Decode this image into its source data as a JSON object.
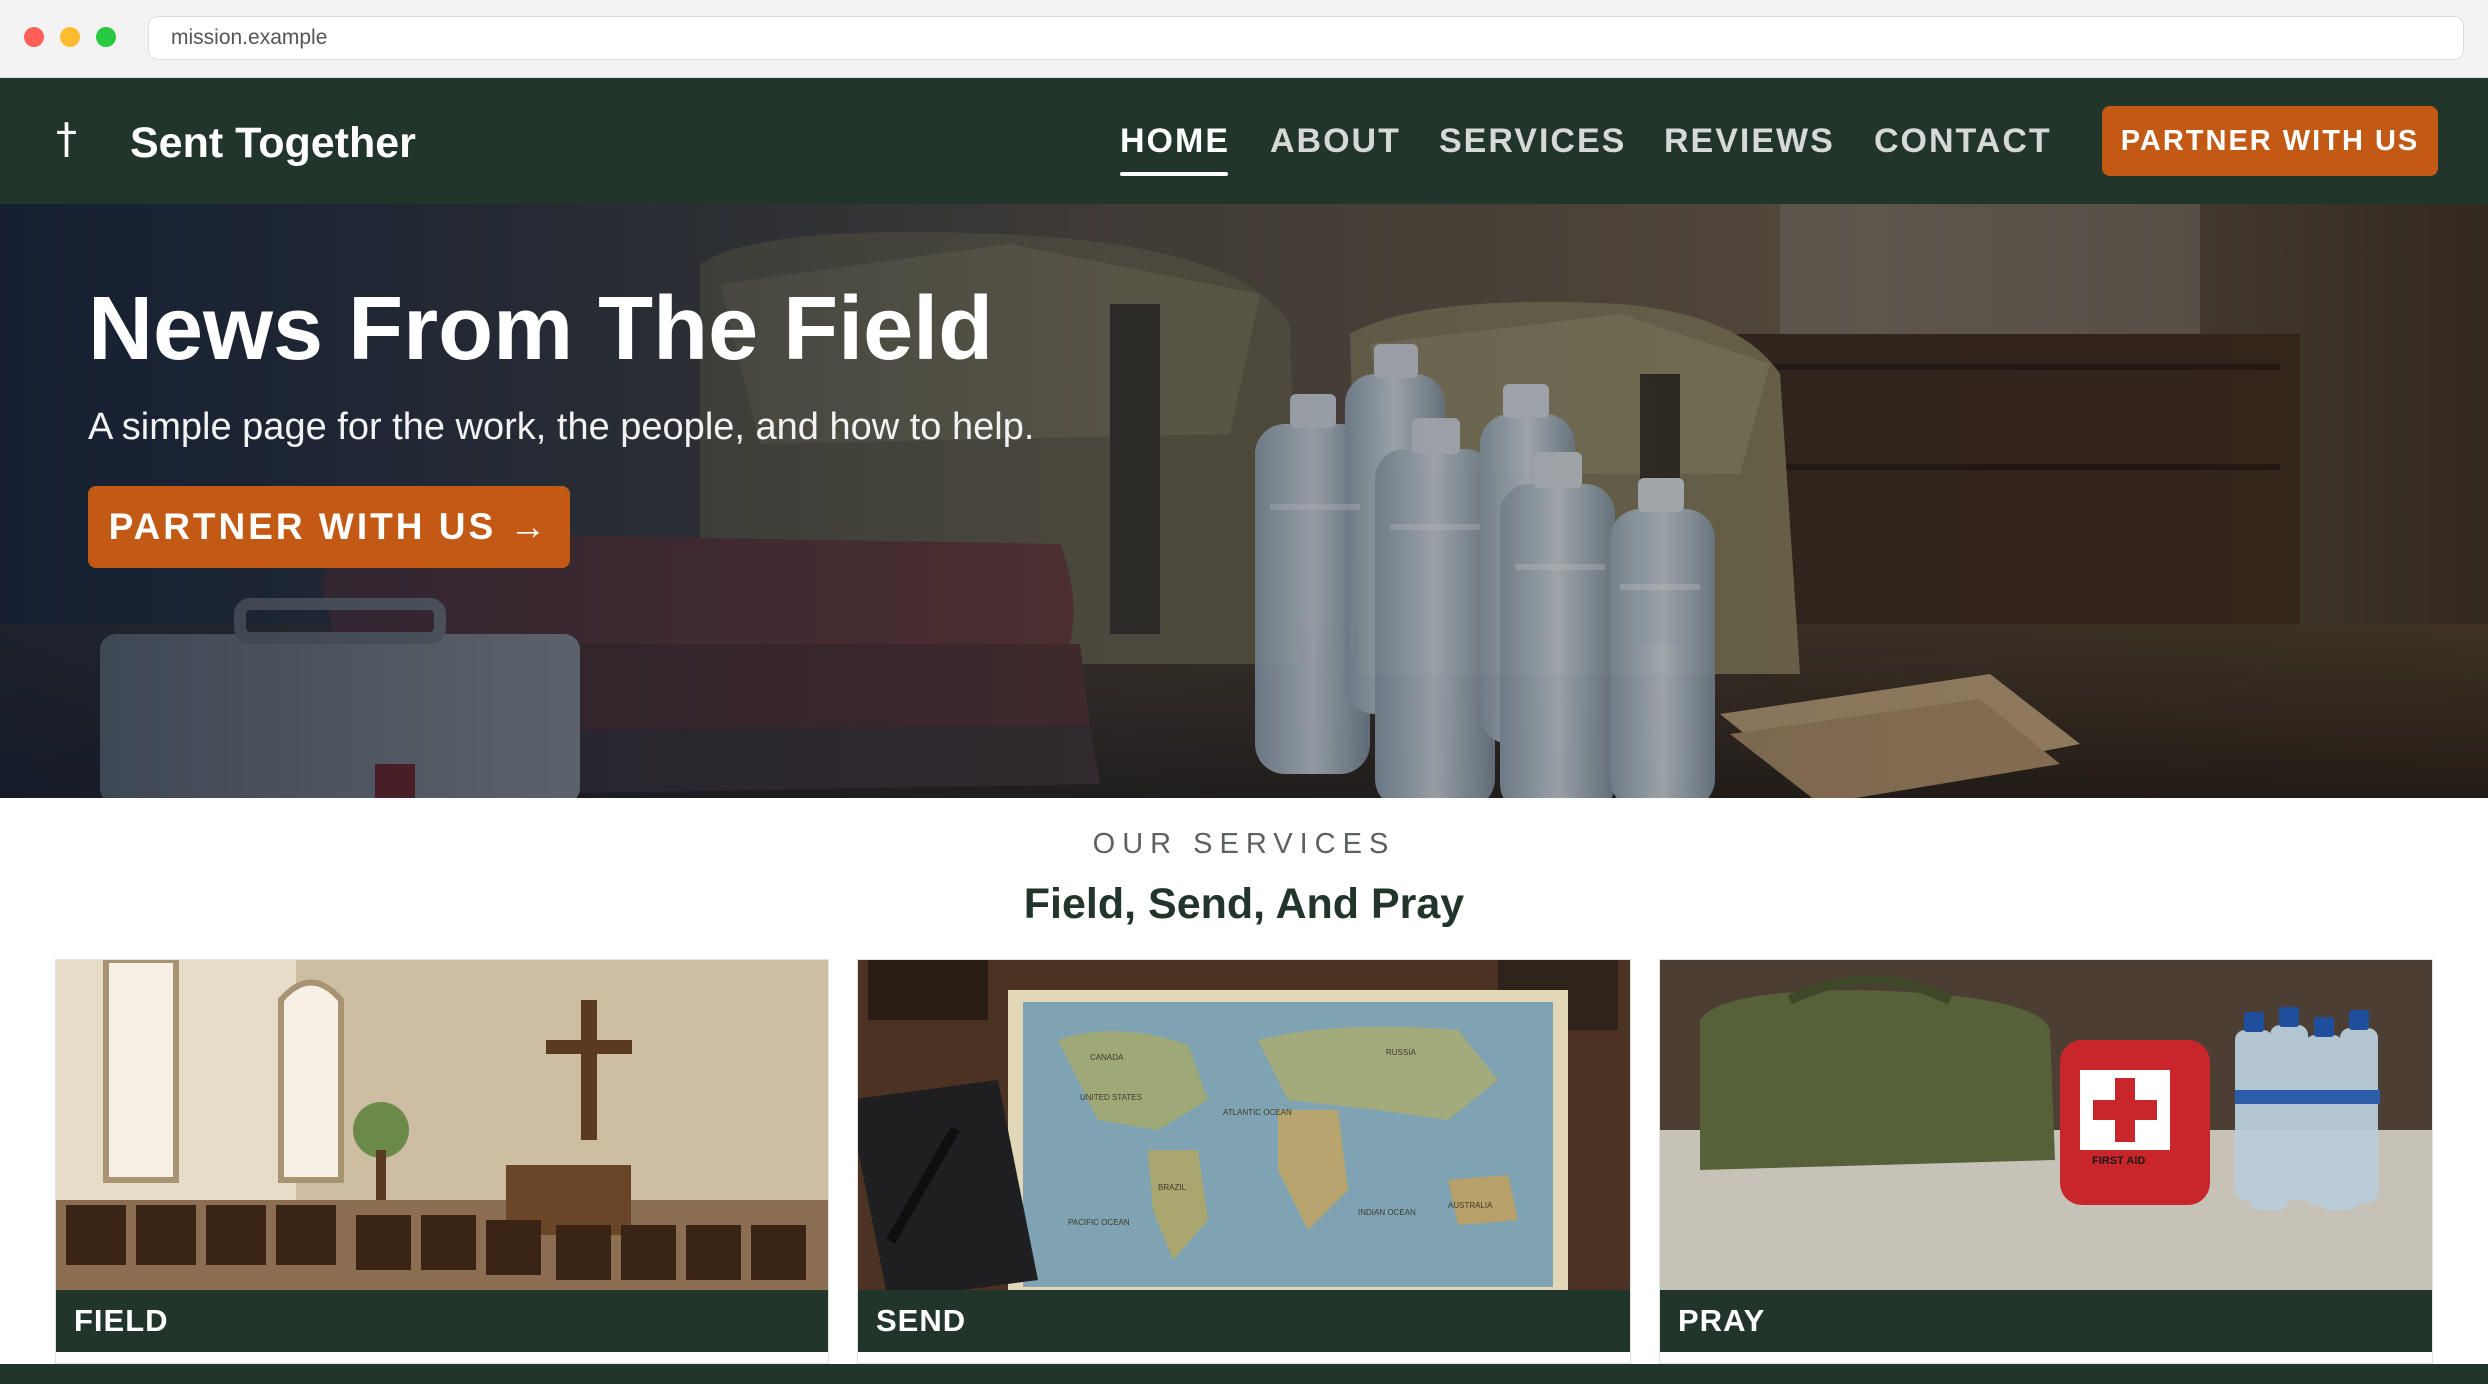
{
  "browser": {
    "url": "mission.example"
  },
  "header": {
    "logo_icon": "†",
    "brand": "Sent Together",
    "nav": [
      "HOME",
      "ABOUT",
      "SERVICES",
      "REVIEWS",
      "CONTACT"
    ],
    "active_nav": "HOME",
    "cta": "PARTNER WITH US"
  },
  "hero": {
    "title": "News From The Field",
    "subtitle": "A simple page for the work, the people, and how to help.",
    "cta": "PARTNER WITH US →"
  },
  "services": {
    "eyebrow": "OUR SERVICES",
    "title": "Field, Send, And Pray",
    "cards": [
      {
        "label": "FIELD",
        "image": "chapel-with-cross-and-chairs"
      },
      {
        "label": "SEND",
        "image": "world-map-with-notebook-and-pen",
        "map_labels": [
          "CANADA",
          "RUSSIA",
          "UNITED STATES",
          "ATLANTIC OCEAN",
          "BRAZIL",
          "PACIFIC OCEAN",
          "INDIAN OCEAN",
          "AUSTRALIA"
        ]
      },
      {
        "label": "PRAY",
        "image": "duffel-bag-first-aid-kit-water-bottles",
        "first_aid_text": "FIRST AID"
      }
    ]
  },
  "colors": {
    "primary_dark": "#22352a",
    "accent": "#c25a16",
    "white": "#ffffff"
  }
}
